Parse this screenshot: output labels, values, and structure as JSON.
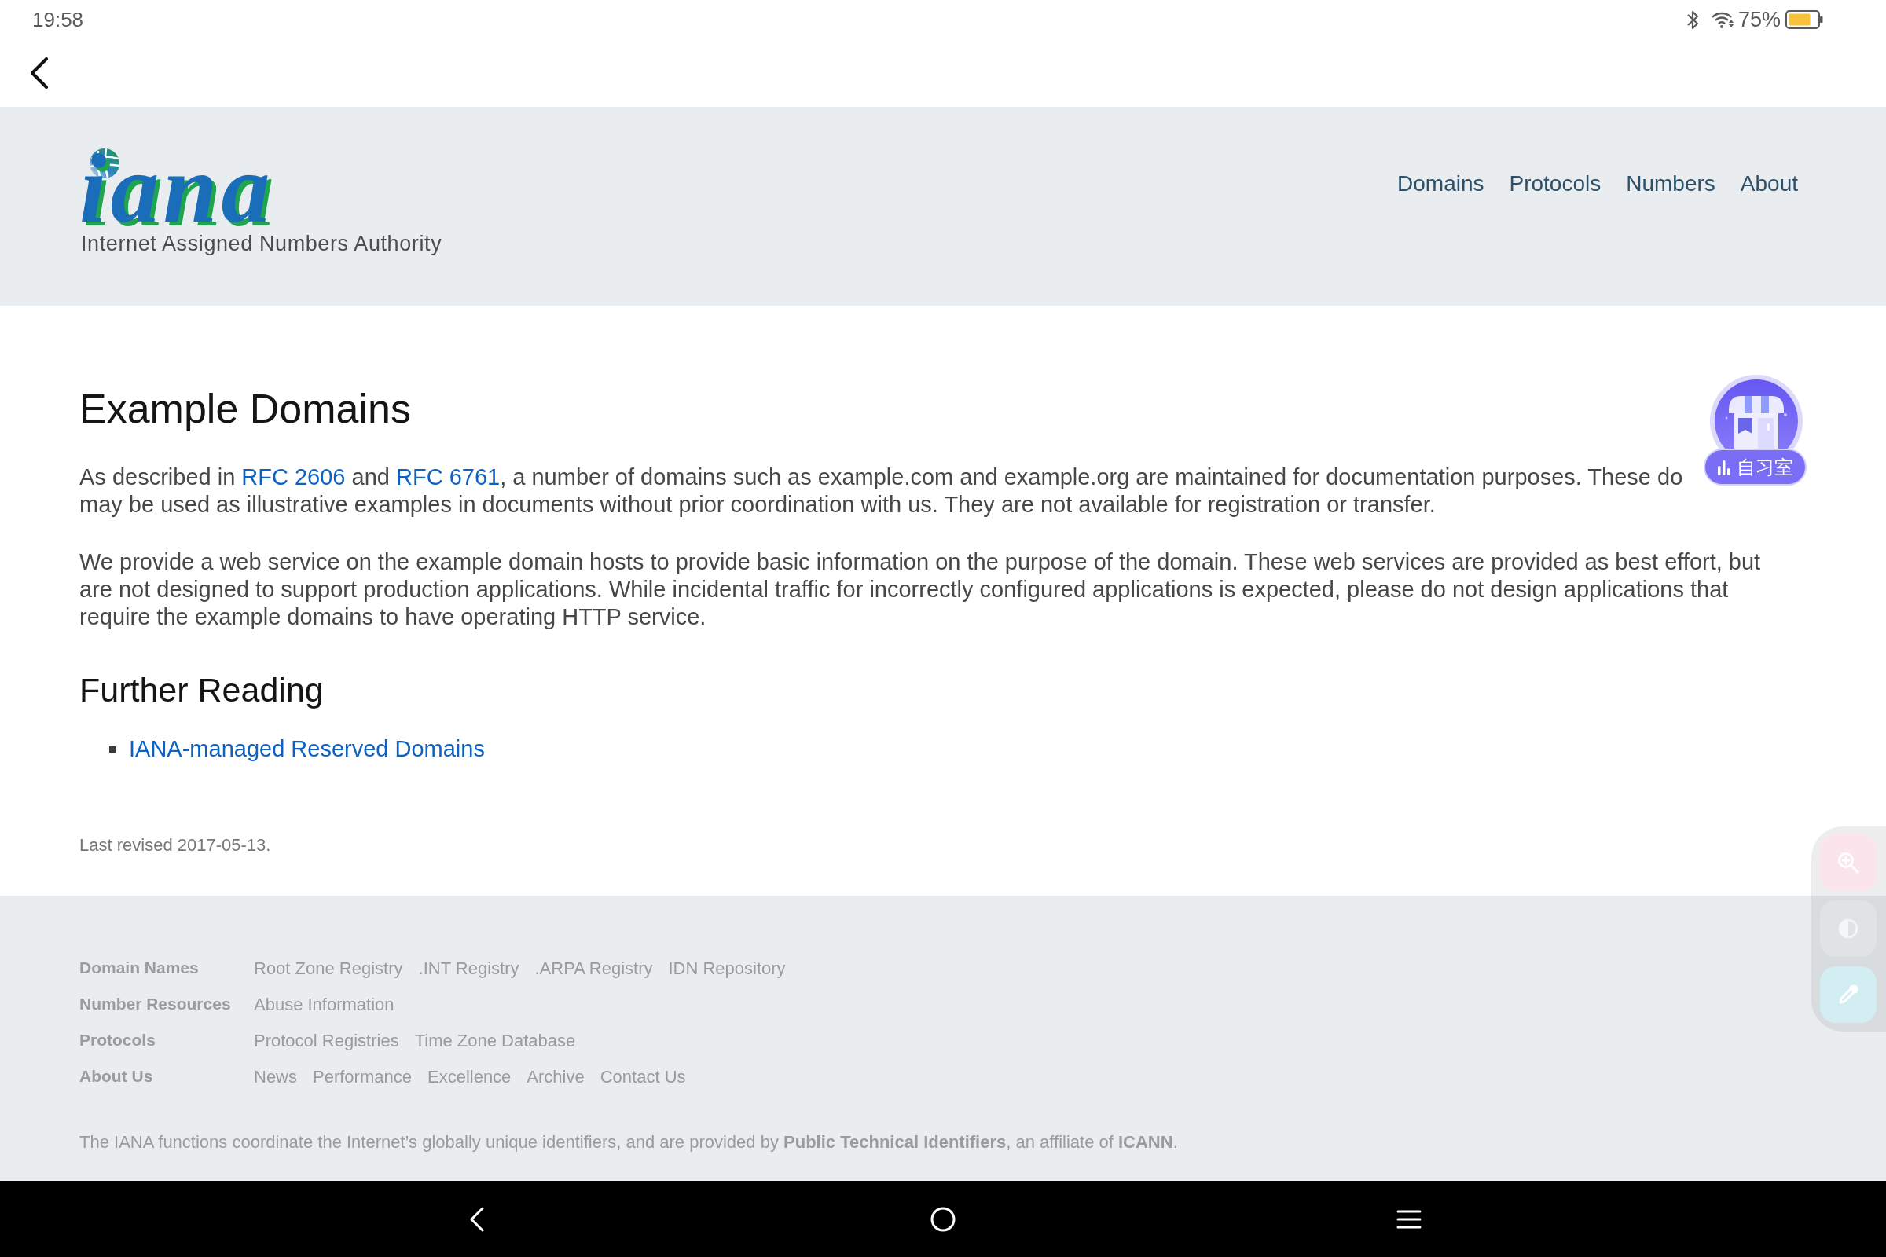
{
  "status_bar": {
    "time": "19:58",
    "battery": "75%"
  },
  "header": {
    "logo_text": "iana",
    "tagline": "Internet Assigned Numbers Authority",
    "nav": [
      "Domains",
      "Protocols",
      "Numbers",
      "About"
    ]
  },
  "content": {
    "title": "Example Domains",
    "paragraphs": [
      {
        "lines": [
          [
            {
              "kind": "text",
              "text": "As described in "
            },
            {
              "kind": "link",
              "text": "RFC 2606"
            },
            {
              "kind": "text",
              "text": " and "
            },
            {
              "kind": "link",
              "text": "RFC 6761"
            },
            {
              "kind": "text",
              "text": ", a number of domains such as example.com and example.org are maintained for documentation purposes. These do"
            }
          ],
          [
            {
              "kind": "text",
              "text": "may be used as illustrative examples in documents without prior coordination with us. They are not available for registration or transfer."
            }
          ]
        ]
      },
      {
        "lines": [
          [
            {
              "kind": "text",
              "text": "We provide a web service on the example domain hosts to provide basic information on the purpose of the domain. These web services are provided as best effort, but"
            }
          ],
          [
            {
              "kind": "text",
              "text": "are not designed to support production applications. While incidental traffic for incorrectly configured applications is expected, please do not design applications that"
            }
          ],
          [
            {
              "kind": "text",
              "text": "require the example domains to have operating HTTP service."
            }
          ]
        ]
      }
    ],
    "subheading": "Further Reading",
    "links": [
      "IANA-managed Reserved Domains"
    ],
    "revised": "Last revised 2017-05-13."
  },
  "footer": {
    "sections": [
      {
        "label": "Domain Names",
        "links": [
          "Root Zone Registry",
          ".INT Registry",
          ".ARPA Registry",
          "IDN Repository"
        ]
      },
      {
        "label": "Number Resources",
        "links": [
          "Abuse Information"
        ]
      },
      {
        "label": "Protocols",
        "links": [
          "Protocol Registries",
          "Time Zone Database"
        ]
      },
      {
        "label": "About Us",
        "links": [
          "News",
          "Performance",
          "Excellence",
          "Archive",
          "Contact Us"
        ]
      }
    ],
    "note": "The IANA functions coordinate the Internet’s globally unique identifiers, and are provided by **Public Technical Identifiers**, an affiliate of **ICANN**."
  },
  "floating_widget": {
    "label": "自习室"
  }
}
